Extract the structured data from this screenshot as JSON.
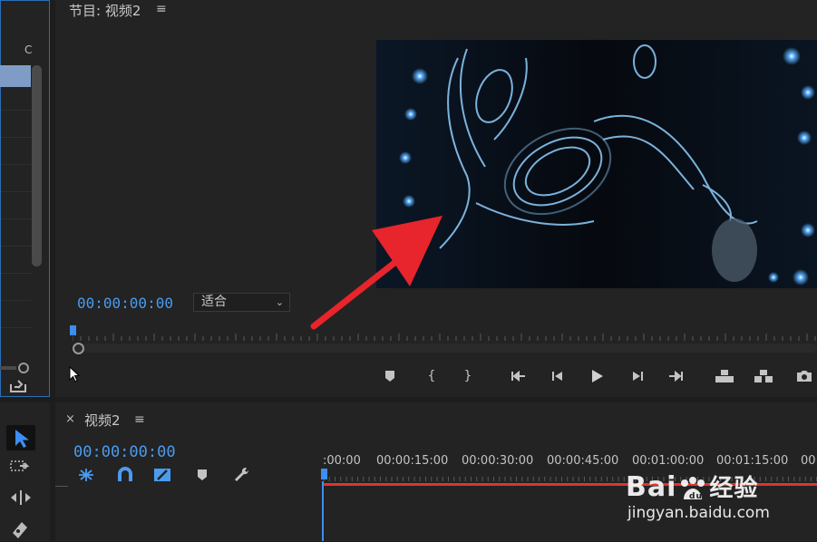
{
  "program_monitor": {
    "title": "节目: 视频2",
    "timecode": "00:00:00:00",
    "fit_select": "适合"
  },
  "timeline": {
    "tab_close": "×",
    "title": "视频2",
    "timecode": "00:00:00:00",
    "ruler_labels": [
      ":00:00",
      "00:00:15:00",
      "00:00:30:00",
      "00:00:45:00",
      "00:01:00:00",
      "00:01:15:00",
      "00"
    ]
  },
  "left_panel": {
    "corner_char": "C"
  },
  "watermark": {
    "brand_a": "Bai",
    "brand_b": "经验",
    "url": "jingyan.baidu.com"
  },
  "colors": {
    "accent_blue": "#4b9bf0",
    "arrow_red": "#e8242c",
    "playhead_red": "#e0342c"
  }
}
